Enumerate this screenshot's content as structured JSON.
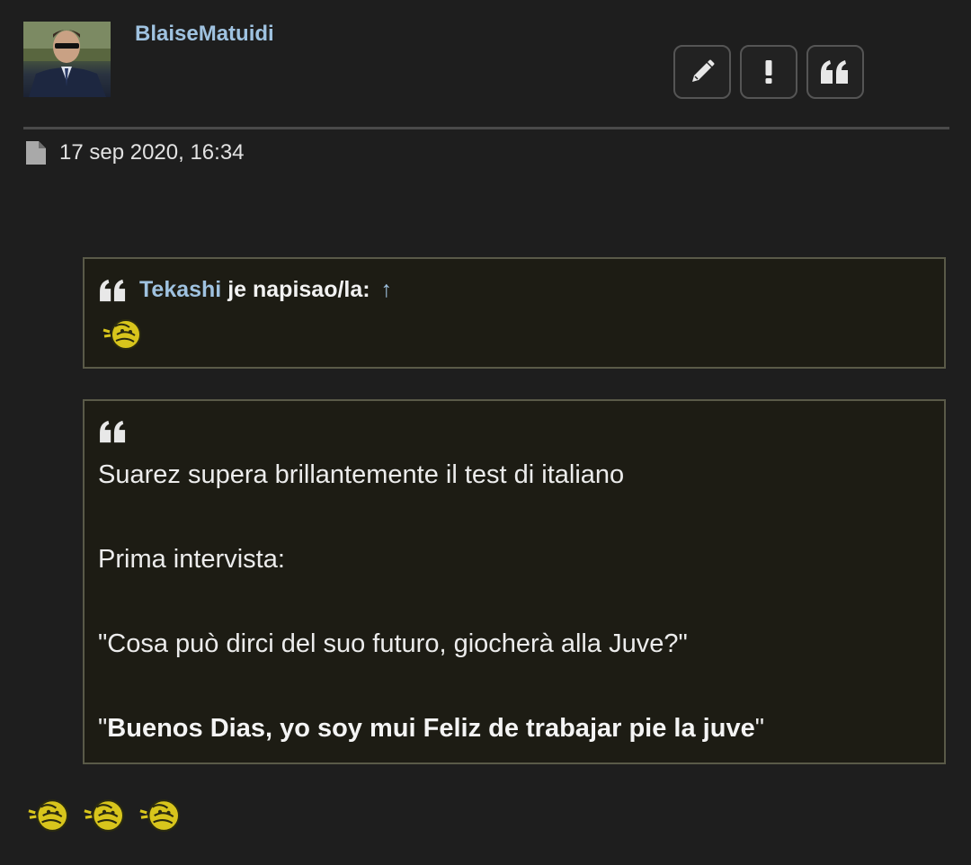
{
  "post": {
    "username": "BlaiseMatuidi",
    "date": "17 sep 2020, 16:34",
    "icons": {
      "edit": "pencil-icon",
      "report": "exclamation-icon",
      "quote": "quote-icon",
      "post": "file-icon"
    }
  },
  "quote1": {
    "author": "Tekashi",
    "wrote": "je napisao/la:",
    "arrow": "↑"
  },
  "quote2": {
    "line1": "Suarez supera brillantemente il test di italiano",
    "line2": "Prima intervista:",
    "line3": "\"Cosa può dirci del suo futuro, giocherà alla Juve?\"",
    "line4_open": "\"",
    "line4_bold": "Buenos Dias, yo soy mui Feliz de trabajar pie la juve",
    "line4_close": "\""
  },
  "colors": {
    "background": "#1e1e1e",
    "link": "#9fc2e0",
    "quote_bg": "#1d1c14",
    "quote_border": "#5a5a48",
    "smiley": "#d8c51c"
  }
}
